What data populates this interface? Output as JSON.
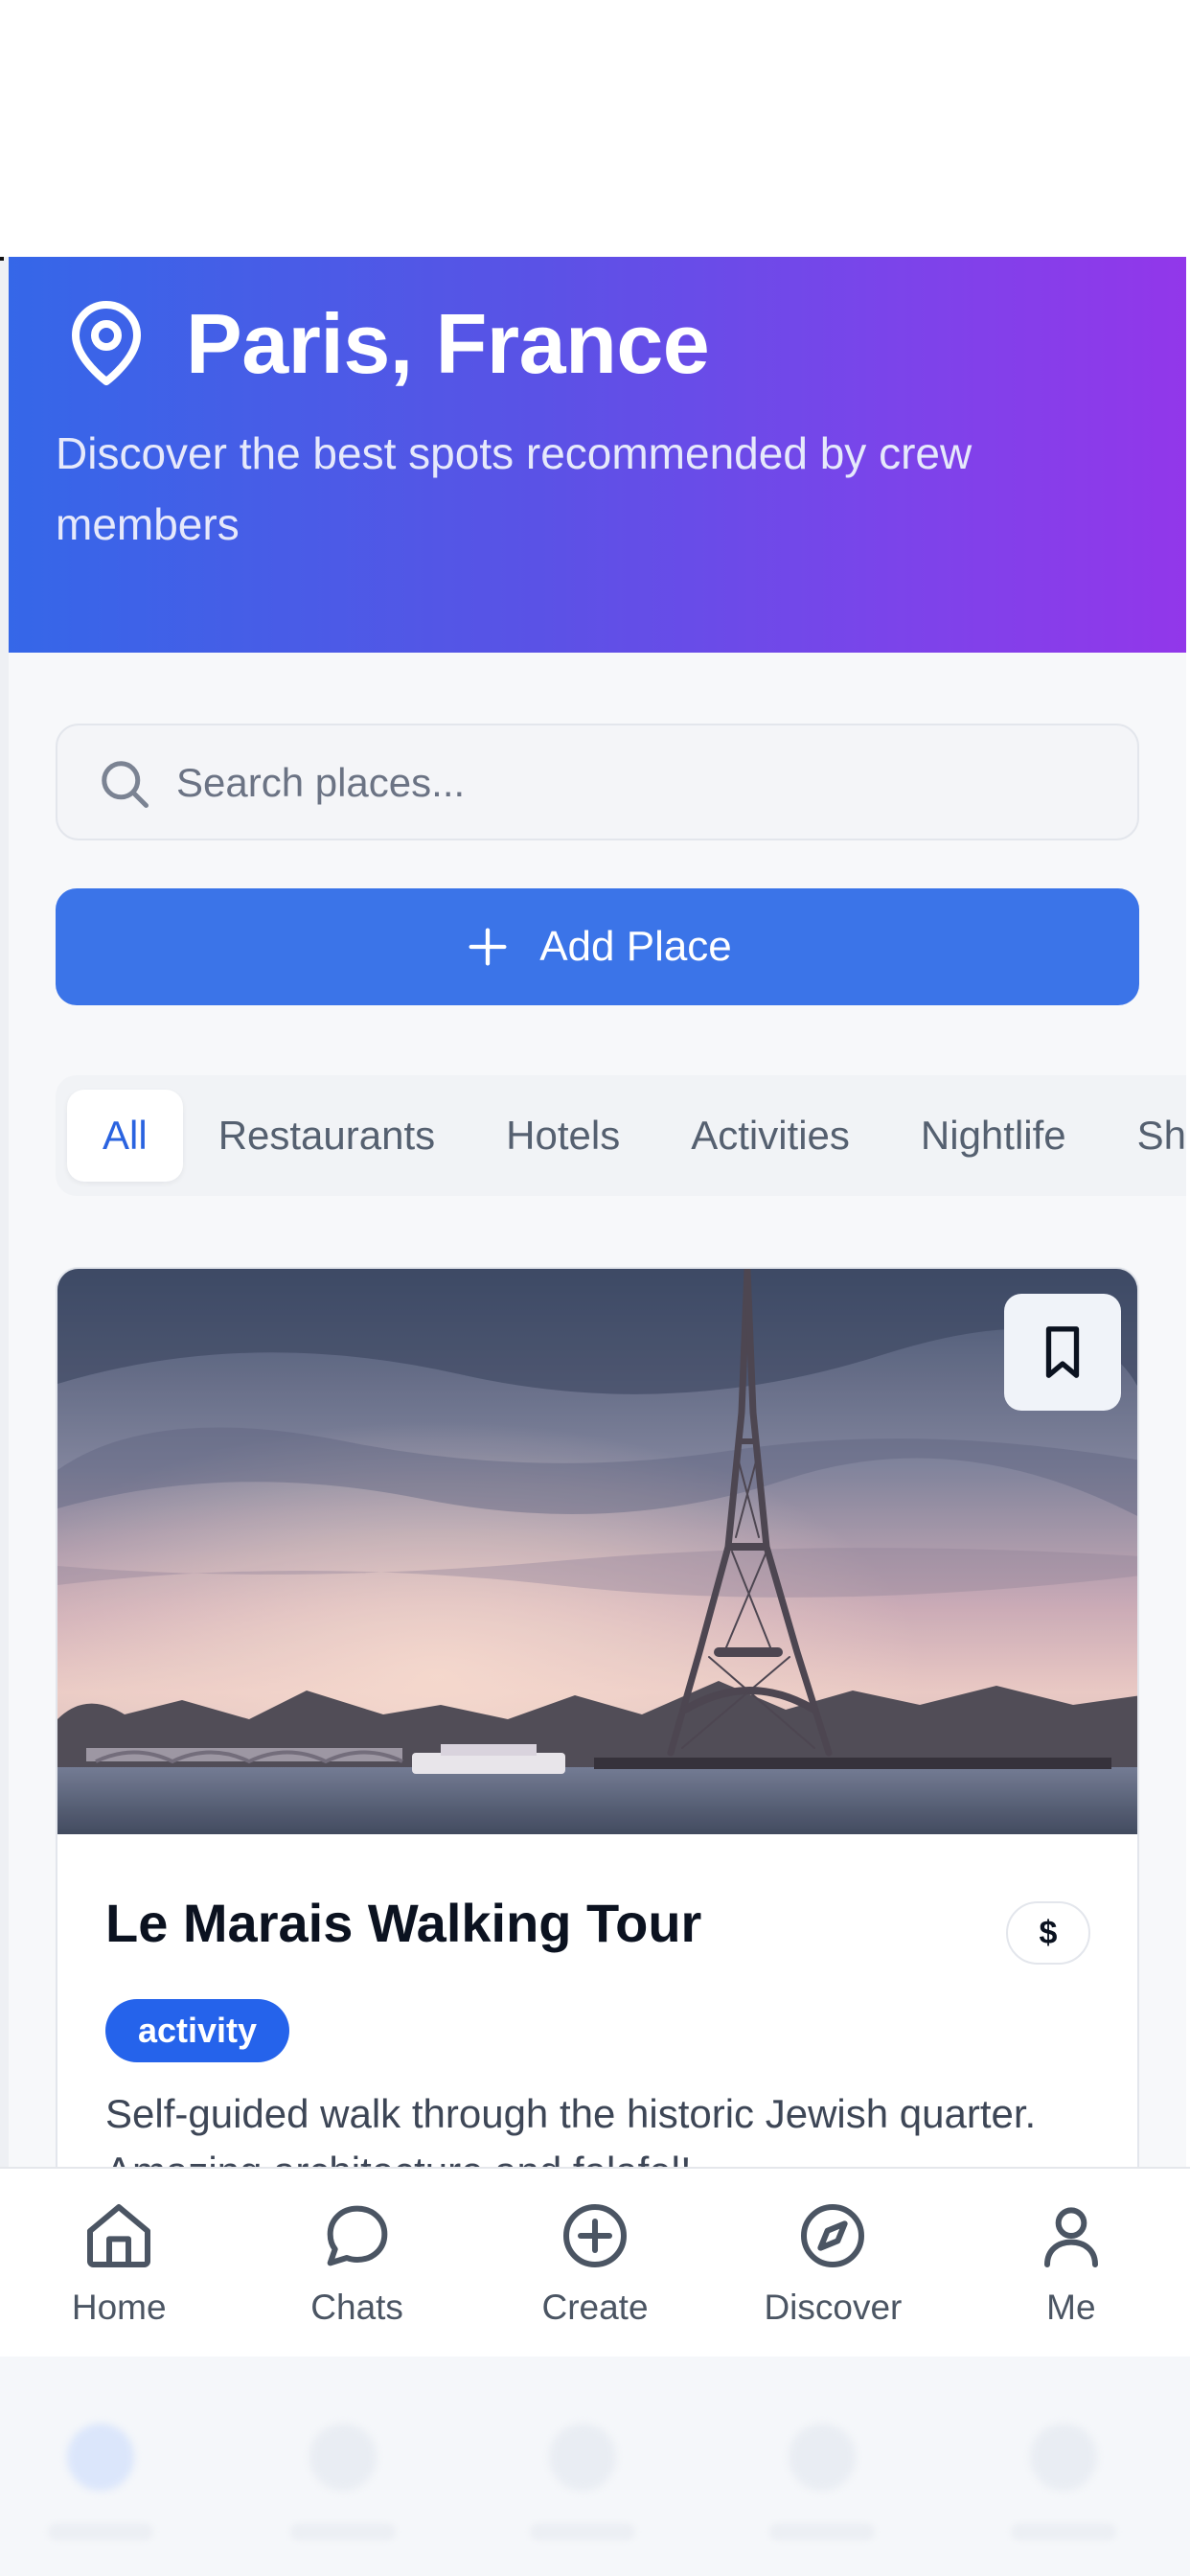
{
  "hero": {
    "title": "Paris, France",
    "subtitle": "Discover the best spots recommended by crew members",
    "icon": "map-pin-icon",
    "gradient_start": "#3567e8",
    "gradient_end": "#9237ea"
  },
  "search": {
    "placeholder": "Search places...",
    "value": "",
    "icon": "search-icon"
  },
  "add_place": {
    "label": "Add Place",
    "icon": "plus-icon",
    "color": "#3b74e8"
  },
  "categories": {
    "active": "All",
    "items": [
      "All",
      "Restaurants",
      "Hotels",
      "Activities",
      "Nightlife",
      "Sh"
    ]
  },
  "place_card": {
    "title": "Le Marais Walking Tour",
    "price": "$",
    "tag": "activity",
    "description": "Self-guided walk through the historic Jewish quarter. Amazing architecture and falafel!",
    "image": "eiffel-tower-photo",
    "bookmark_icon": "bookmark-icon",
    "tag_color": "#2563eb"
  },
  "bottom_nav": {
    "items": [
      {
        "label": "Home",
        "icon": "home-icon"
      },
      {
        "label": "Chats",
        "icon": "chat-bubble-icon"
      },
      {
        "label": "Create",
        "icon": "plus-circle-icon"
      },
      {
        "label": "Discover",
        "icon": "compass-icon"
      },
      {
        "label": "Me",
        "icon": "user-icon"
      }
    ]
  }
}
